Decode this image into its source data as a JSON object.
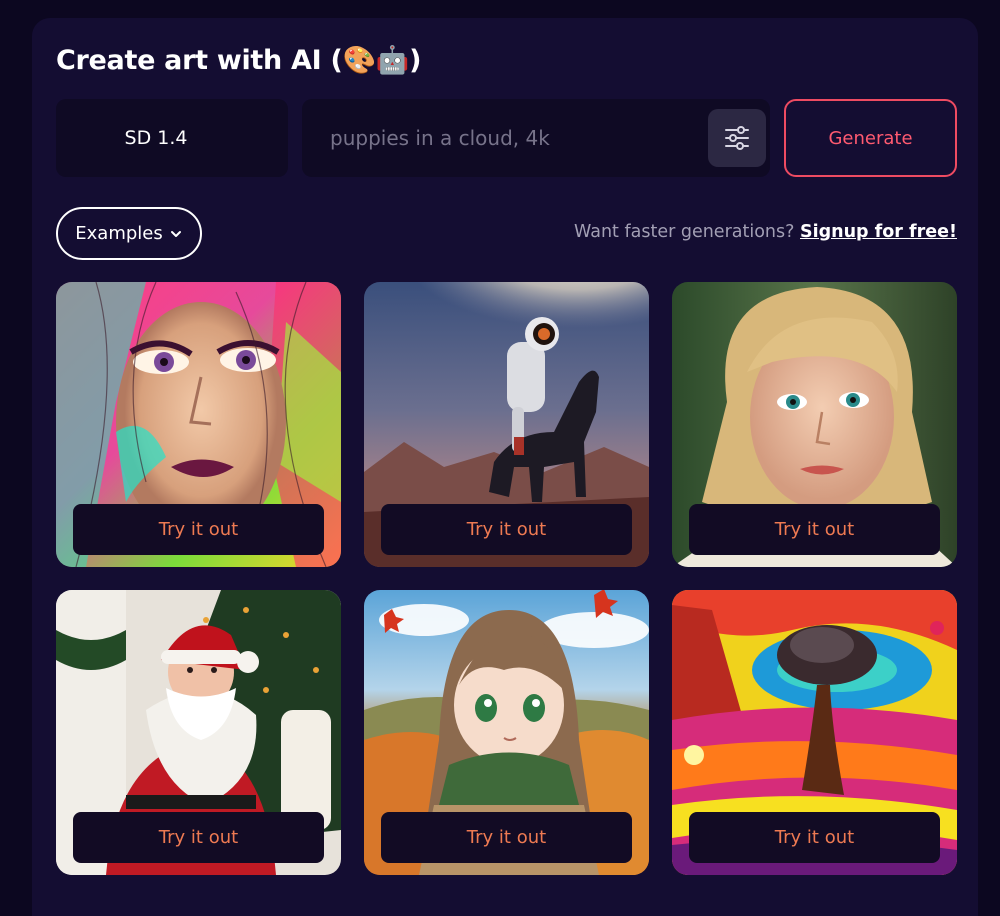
{
  "header": {
    "title": "Create art with AI (🎨🤖)"
  },
  "controls": {
    "model_value": "SD 1.4",
    "prompt_placeholder": "puppies in a cloud, 4k",
    "prompt_value": "",
    "generate_label": "Generate",
    "examples_label": "Examples"
  },
  "promo": {
    "text": "Want faster generations?",
    "link": "Signup for free!"
  },
  "examples": [
    {
      "image": "portrait-woman-colorful-paint",
      "button": "Try it out"
    },
    {
      "image": "astronaut-riding-horse",
      "button": "Try it out"
    },
    {
      "image": "portrait-blonde-woman",
      "button": "Try it out"
    },
    {
      "image": "santa-claus-christmas-tree",
      "button": "Try it out"
    },
    {
      "image": "anime-girl-autumn-scarf",
      "button": "Try it out"
    },
    {
      "image": "psychedelic-tree-landscape",
      "button": "Try it out"
    }
  ],
  "colors": {
    "background": "#0c0720",
    "panel": "#140d32",
    "accent_red": "#ee4b62",
    "button_text_orange": "#ee7a52"
  }
}
